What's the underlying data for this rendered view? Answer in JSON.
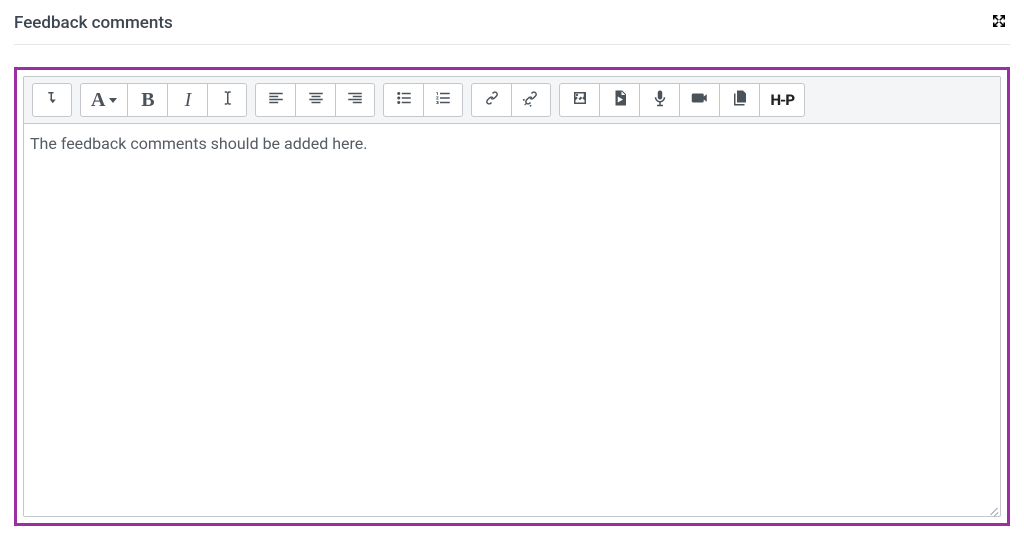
{
  "header": {
    "title": "Feedback comments"
  },
  "toolbar": {
    "toggle": "toggle-toolbar",
    "paragraph_glyph": "A",
    "bold_glyph": "B",
    "italic_glyph": "I",
    "h5p_label": "H-P"
  },
  "editor": {
    "content": "The feedback comments should be added here."
  }
}
